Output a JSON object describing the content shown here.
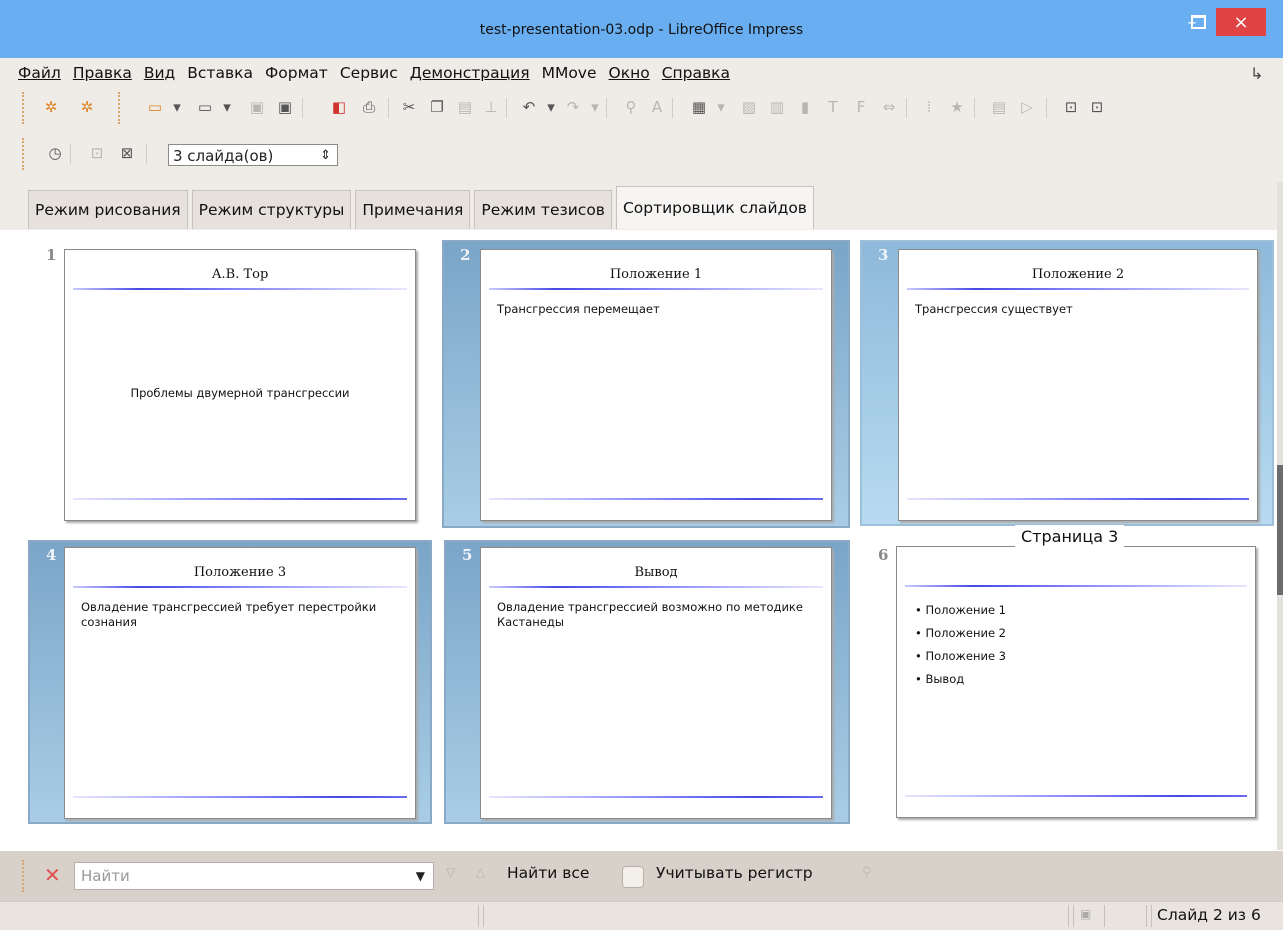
{
  "window": {
    "title": "test-presentation-03.odp - LibreOffice Impress",
    "minimize": "–",
    "close": "×"
  },
  "menu": {
    "items": [
      "Файл",
      "Правка",
      "Вид",
      "Вставка",
      "Формат",
      "Сервис",
      "Демонстрация",
      "MMove",
      "Окно",
      "Справка"
    ]
  },
  "toolbar2": {
    "slides_per_row": "3 слайда(ов)"
  },
  "tabs": [
    "Режим рисования",
    "Режим структуры",
    "Примечания",
    "Режим тезисов",
    "Сортировщик слайдов"
  ],
  "slides": [
    {
      "number": "1",
      "title": "А.В. Тор",
      "body": "Проблемы двумерной трансгрессии"
    },
    {
      "number": "2",
      "title": "Положение 1",
      "body": "Трансгрессия перемещает"
    },
    {
      "number": "3",
      "title": "Положение 2",
      "body": "Трансгрессия существует"
    },
    {
      "number": "4",
      "title": "Положение 3",
      "body": "Овладение трансгрессией требует перестройки сознания"
    },
    {
      "number": "5",
      "title": "Вывод",
      "body": "Овладение трансгрессией возможно по методике Кастанеды"
    },
    {
      "number": "6",
      "title": "",
      "bullets": [
        "Положение 1",
        "Положение 2",
        "Положение 3",
        "Вывод"
      ]
    }
  ],
  "tooltip": "Страница 3",
  "findbar": {
    "placeholder": "Найти",
    "find_all": "Найти все",
    "match_case": "Учитывать регистр"
  },
  "statusbar": {
    "slide_info": "Слайд 2 из 6"
  }
}
